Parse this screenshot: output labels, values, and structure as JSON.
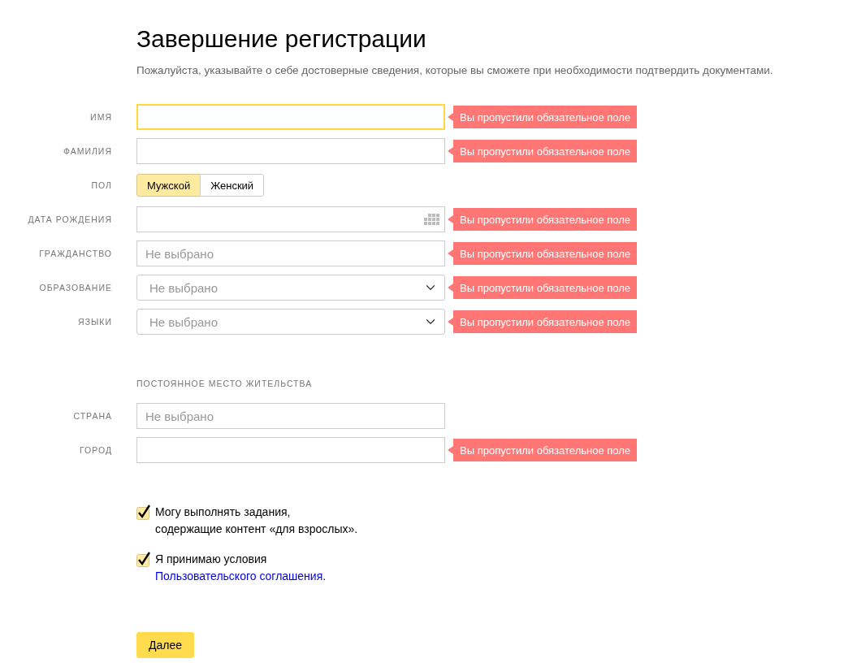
{
  "title": "Завершение регистрации",
  "subtitle": "Пожалуйста, указывайте о себе достоверные сведения, которые вы сможете при необходимости подтвердить документами.",
  "fields": [
    {
      "label": "ИМЯ",
      "kind": "text",
      "focused": true,
      "error": "Вы пропустили обязательное поле"
    },
    {
      "label": "ФАМИЛИЯ",
      "kind": "text",
      "focused": false,
      "error": "Вы пропустили обязательное поле"
    },
    {
      "label": "ПОЛ",
      "kind": "toggle",
      "options": [
        {
          "label": "Мужской",
          "selected": true
        },
        {
          "label": "Женский",
          "selected": false
        }
      ]
    },
    {
      "label": "ДАТА РОЖДЕНИЯ",
      "kind": "date",
      "focused": false,
      "error": "Вы пропустили обязательное поле"
    },
    {
      "label": "ГРАЖДАНСТВО",
      "kind": "text",
      "focused": false,
      "placeholder": "Не выбрано",
      "error": "Вы пропустили обязательное поле"
    },
    {
      "label": "ОБРАЗОВАНИЕ",
      "kind": "select",
      "focused": false,
      "placeholder": "Не выбрано",
      "error": "Вы пропустили обязательное поле"
    },
    {
      "label": "ЯЗЫКИ",
      "kind": "select",
      "focused": false,
      "placeholder": "Не выбрано",
      "error": "Вы пропустили обязательное поле"
    }
  ],
  "residence": {
    "heading": "ПОСТОЯННОЕ МЕСТО ЖИТЕЛЬСТВА",
    "fields": [
      {
        "label": "СТРАНА",
        "kind": "text",
        "focused": false,
        "placeholder": "Не выбрано"
      },
      {
        "label": "ГОРОД",
        "kind": "text",
        "focused": false,
        "error": "Вы пропустили обязательное поле"
      }
    ]
  },
  "checkboxes": [
    {
      "text": "Могу выполнять задания,\nсодержащие контент «для взрослых».",
      "checked": true
    },
    {
      "text": "Я принимаю условия",
      "link": "Пользовательского соглашения",
      "suffix": ".",
      "checked": true
    }
  ],
  "next_button": "Далее"
}
